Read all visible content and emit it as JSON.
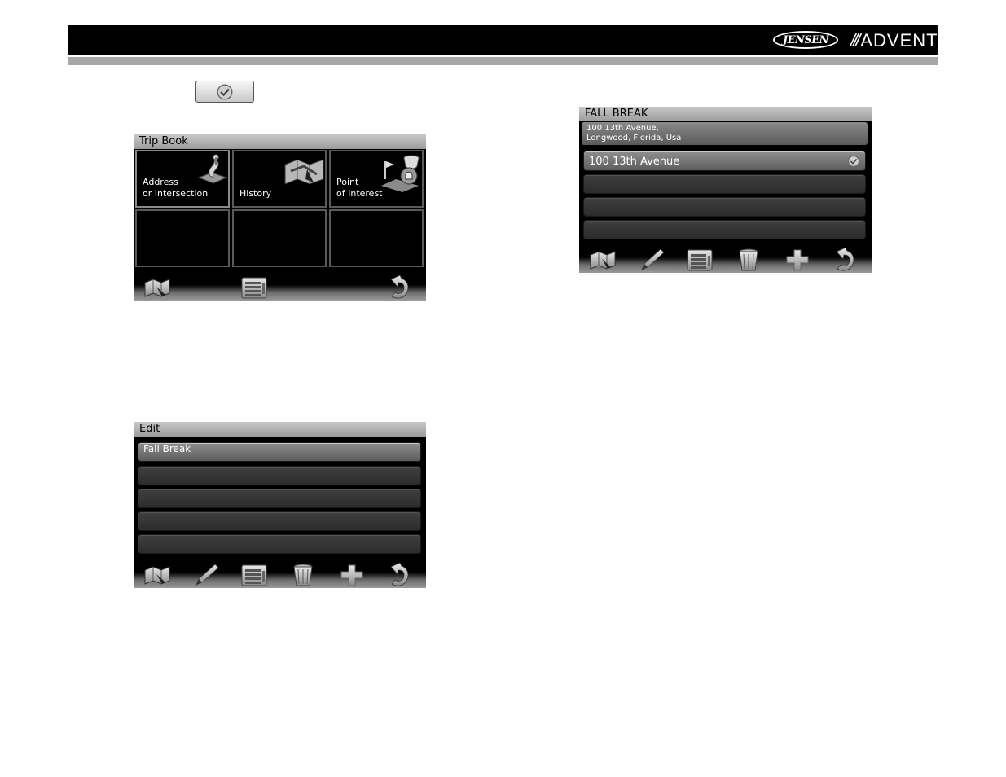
{
  "header": {
    "brand_left": "JENSEN",
    "brand_right_prefix": "///",
    "brand_right": "ADVENT"
  },
  "trip_book": {
    "title": "Trip Book",
    "tiles": [
      {
        "line1": "Address",
        "line2": "or Intersection",
        "icon": "address-icon"
      },
      {
        "line1": "",
        "line2": "History",
        "icon": "history-map-icon"
      },
      {
        "line1": "Point",
        "line2": "of Interest",
        "icon": "poi-icon"
      }
    ],
    "toolbar": [
      "map-icon",
      "list-icon",
      "back-arrow-icon"
    ]
  },
  "edit": {
    "title": "Edit",
    "rows": [
      "Fall Break",
      "",
      "",
      "",
      ""
    ],
    "toolbar": [
      "map-icon",
      "pencil-icon",
      "list-icon",
      "trash-icon",
      "plus-icon",
      "back-arrow-icon"
    ]
  },
  "fall_break": {
    "title": "FALL BREAK",
    "address_line1": "100 13th Avenue,",
    "address_line2": "Longwood, Florida, Usa",
    "rows": [
      "100 13th Avenue",
      "",
      "",
      ""
    ],
    "toolbar": [
      "map-icon",
      "pencil-icon",
      "list-icon",
      "trash-icon",
      "plus-icon",
      "back-arrow-icon"
    ]
  }
}
